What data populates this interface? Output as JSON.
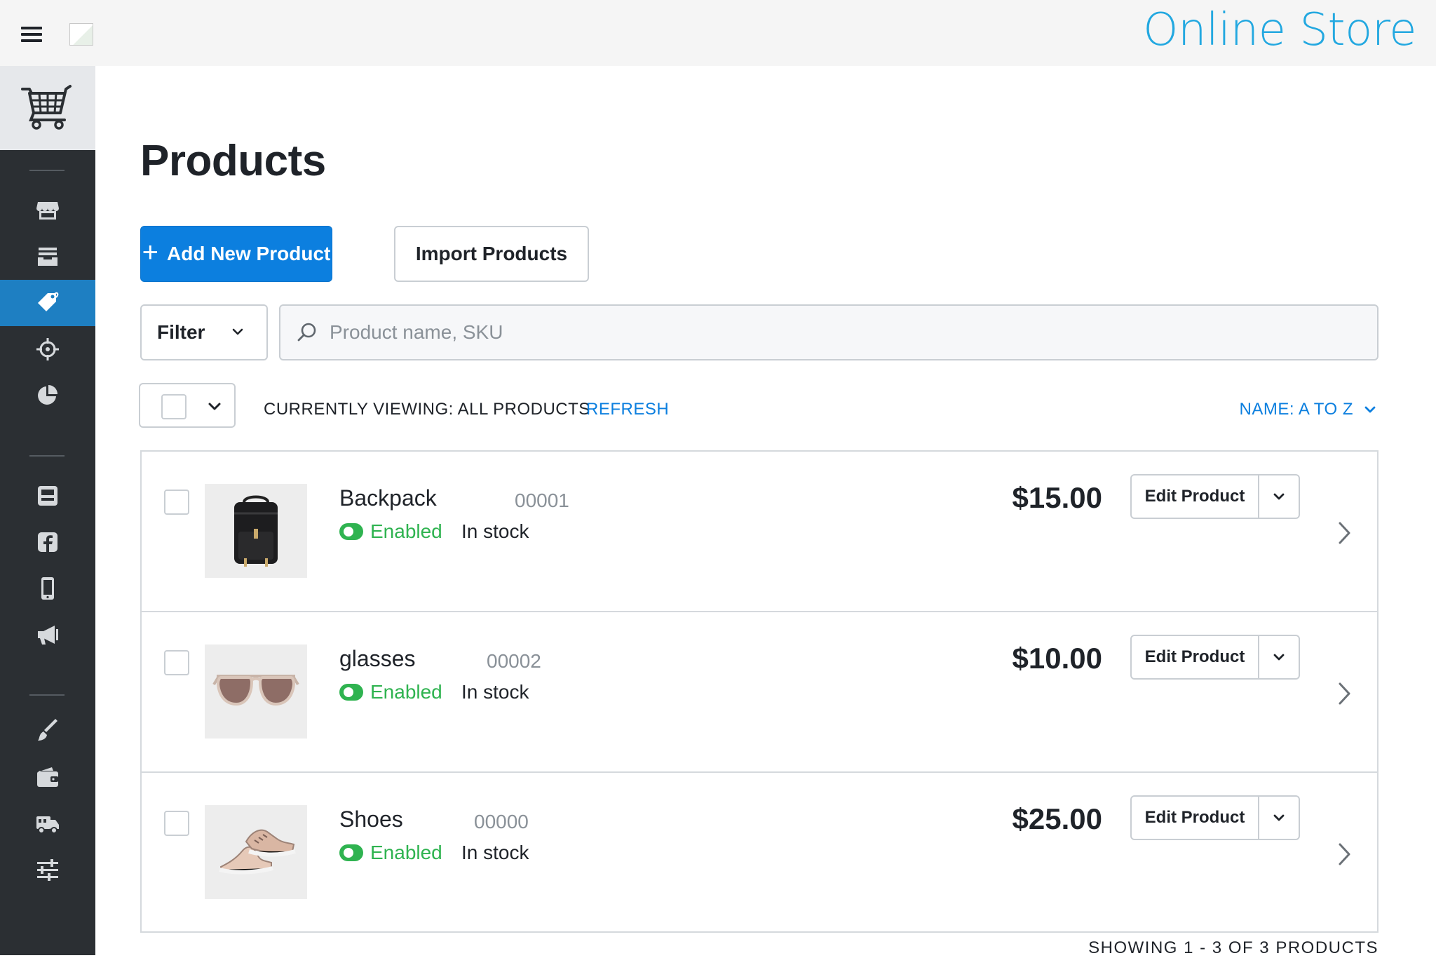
{
  "header": {
    "brand": "Online Store"
  },
  "sidebar": {
    "items": [
      {
        "icon": "storefront-icon",
        "active": false
      },
      {
        "icon": "inbox-icon",
        "active": false
      },
      {
        "icon": "tags-icon",
        "active": true
      },
      {
        "icon": "crosshair-icon",
        "active": false
      },
      {
        "icon": "pie-chart-icon",
        "active": false
      },
      {
        "icon": "store-register-icon",
        "active": false
      },
      {
        "icon": "facebook-icon",
        "active": false
      },
      {
        "icon": "mobile-icon",
        "active": false
      },
      {
        "icon": "megaphone-icon",
        "active": false
      },
      {
        "icon": "paintbrush-icon",
        "active": false
      },
      {
        "icon": "wallet-icon",
        "active": false
      },
      {
        "icon": "truck-icon",
        "active": false
      },
      {
        "icon": "sliders-icon",
        "active": false
      }
    ]
  },
  "main": {
    "title": "Products",
    "add_button": "Add New Product",
    "import_button": "Import Products",
    "filter_label": "Filter",
    "search_placeholder": "Product name, SKU",
    "viewing_text": "CURRENTLY VIEWING: ALL PRODUCTS",
    "refresh_label": "REFRESH",
    "sort_label": "NAME: A TO Z",
    "pagination_text": "SHOWING 1 - 3 OF 3 PRODUCTS"
  },
  "products": [
    {
      "name": "Backpack",
      "sku": "00001",
      "status": "Enabled",
      "stock": "In stock",
      "price": "$15.00",
      "edit_label": "Edit Product",
      "thumb": "backpack-image"
    },
    {
      "name": "glasses",
      "sku": "00002",
      "status": "Enabled",
      "stock": "In stock",
      "price": "$10.00",
      "edit_label": "Edit Product",
      "thumb": "sunglasses-image"
    },
    {
      "name": "Shoes",
      "sku": "00000",
      "status": "Enabled",
      "stock": "In stock",
      "price": "$25.00",
      "edit_label": "Edit Product",
      "thumb": "shoes-image"
    }
  ],
  "colors": {
    "accent": "#0c7fdf",
    "brand": "#23a8e0",
    "enabled": "#2fb350",
    "sidebar_bg": "#2b2f33",
    "sidebar_active": "#1e7fc2"
  }
}
